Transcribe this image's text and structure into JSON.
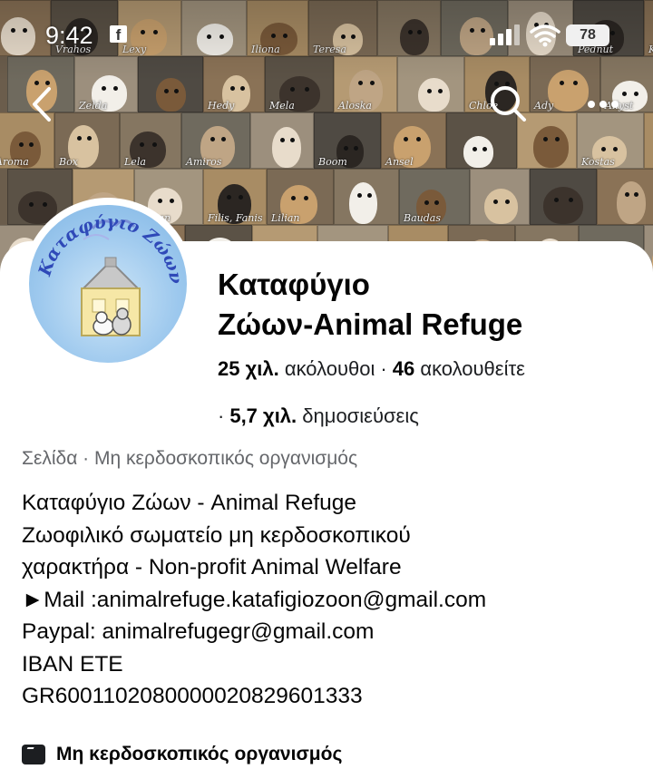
{
  "status_bar": {
    "time": "9:42",
    "notification_icon": "facebook-icon",
    "battery": "78"
  },
  "cover": {
    "photo_captions": [
      "Vrahos",
      "Lexy",
      "Iliona",
      "Teresa",
      "Pednut",
      "Klean",
      "Zelda",
      "Hedy",
      "Mela",
      "Aloska",
      "Chloe",
      "Ady",
      "Allyst",
      "Aroma",
      "Box",
      "Lela",
      "Amiros",
      "Boom",
      "Ansel",
      "Kostas",
      "Kritan",
      "Filis, Fanis und Fokas",
      "Lilian",
      "Baudas"
    ]
  },
  "nav": {
    "back_icon": "back-arrow-icon",
    "search_icon": "search-icon",
    "more_icon": "more-options-icon"
  },
  "profile": {
    "avatar_text": "Καταφύγιο Ζώων",
    "name_line1": "Καταφύγιο",
    "name_line2": "Ζώων-Animal Refuge",
    "followers_value": "25 χιλ.",
    "followers_label": "ακόλουθοι",
    "following_value": "46",
    "following_label": "ακολουθείτε",
    "posts_value": "5,7 χιλ.",
    "posts_label": "δημοσιεύσεις",
    "separator": "·"
  },
  "category_line": "Σελίδα · Μη κερδοσκοπικός οργανισμός",
  "bio_lines": [
    "Καταφύγιο Ζώων - Animal Refuge",
    "Ζωοφιλικό σωματείο μη κερδοσκοπικού",
    "χαρακτήρα - Non-profit Animal Welfare",
    "►Mail :animalrefuge.katafigiozoon@gmail.com",
    "Paypal: animalrefugegr@gmail.com",
    "IBAN ETE",
    "GR6001102080000020829601333"
  ],
  "info_row": {
    "icon": "clapperboard-icon",
    "text": "Μη κερδοσκοπικός οργανισμός"
  },
  "colors": {
    "text_primary": "#050505",
    "text_secondary": "#65676b",
    "panel_bg": "#ffffff"
  }
}
